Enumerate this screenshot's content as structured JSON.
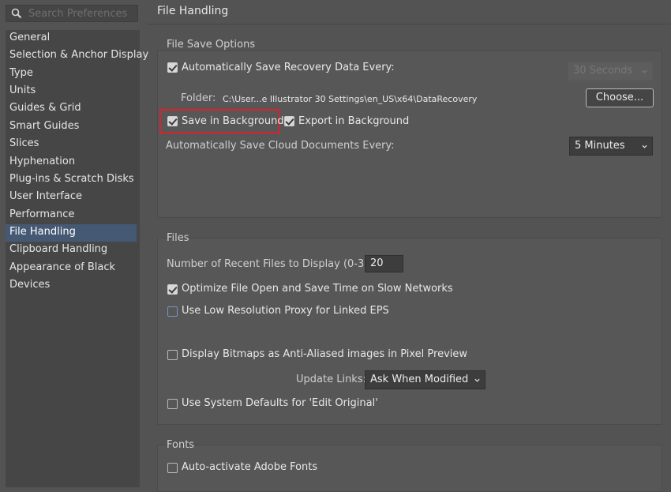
{
  "search": {
    "placeholder": "Search Preferences"
  },
  "sidebar": {
    "items": [
      {
        "label": "General"
      },
      {
        "label": "Selection & Anchor Display"
      },
      {
        "label": "Type"
      },
      {
        "label": "Units"
      },
      {
        "label": "Guides & Grid"
      },
      {
        "label": "Smart Guides"
      },
      {
        "label": "Slices"
      },
      {
        "label": "Hyphenation"
      },
      {
        "label": "Plug-ins & Scratch Disks"
      },
      {
        "label": "User Interface"
      },
      {
        "label": "Performance"
      },
      {
        "label": "File Handling"
      },
      {
        "label": "Clipboard Handling"
      },
      {
        "label": "Appearance of Black"
      },
      {
        "label": "Devices"
      }
    ],
    "selected_index": 11
  },
  "pane": {
    "title": "File Handling"
  },
  "file_save": {
    "title": "File Save Options",
    "auto_save_label": "Automatically Save Recovery Data Every:",
    "auto_save_checked": true,
    "auto_save_interval": "30 Seconds",
    "folder_label": "Folder:",
    "folder_path": "C:\\User...e Illustrator 30 Settings\\en_US\\x64\\DataRecovery",
    "choose_label": "Choose...",
    "save_bg_label": "Save in Background",
    "save_bg_checked": true,
    "export_bg_label": "Export in Background",
    "export_bg_checked": true,
    "cloud_label": "Automatically Save Cloud Documents Every:",
    "cloud_interval": "5 Minutes"
  },
  "files": {
    "title": "Files",
    "recent_label": "Number of Recent Files to Display (0-30):",
    "recent_value": "20",
    "optimize_label": "Optimize File Open and Save Time on Slow Networks",
    "optimize_checked": true,
    "lowres_label": "Use Low Resolution Proxy for Linked EPS",
    "lowres_checked": false,
    "bitmaps_label": "Display Bitmaps as Anti-Aliased images in Pixel Preview",
    "bitmaps_checked": false,
    "update_links_label": "Update Links:",
    "update_links_value": "Ask When Modified",
    "sysdefaults_label": "Use System Defaults for 'Edit Original'",
    "sysdefaults_checked": false
  },
  "fonts": {
    "title": "Fonts",
    "auto_activate_label": "Auto-activate Adobe Fonts",
    "auto_activate_checked": false
  },
  "colors": {
    "selection": "#465974",
    "highlight": "#d9222c"
  }
}
